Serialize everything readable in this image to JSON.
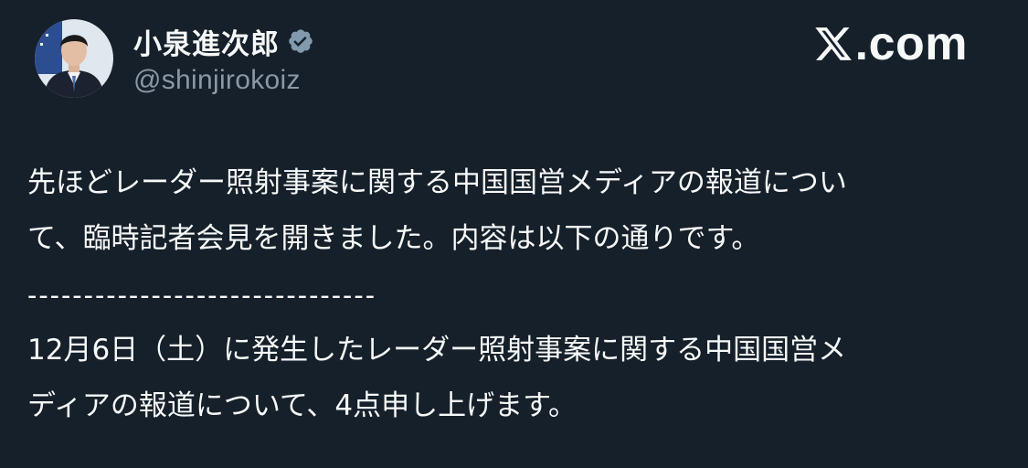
{
  "tweet": {
    "author": {
      "display_name": "小泉進次郎",
      "handle": "@shinjirokoiz",
      "verified_icon": "verified-badge-icon",
      "avatar_icon": "avatar-photo"
    },
    "brand": {
      "logo_icon": "x-logo-icon",
      "text": ".com"
    },
    "lines": [
      "先ほどレーダー照射事案に関する中国国営メディアの報道につい",
      "て、臨時記者会見を開きました。内容は以下の通りです。",
      "-------------------------------",
      "12月6日（土）に発生したレーダー照射事案に関する中国国営メ",
      "ディアの報道について、4点申し上げます。"
    ]
  },
  "colors": {
    "background": "#15202b",
    "text": "#f7f9f9",
    "secondary_text": "#8b98a5",
    "verified_badge": "#829aab"
  }
}
